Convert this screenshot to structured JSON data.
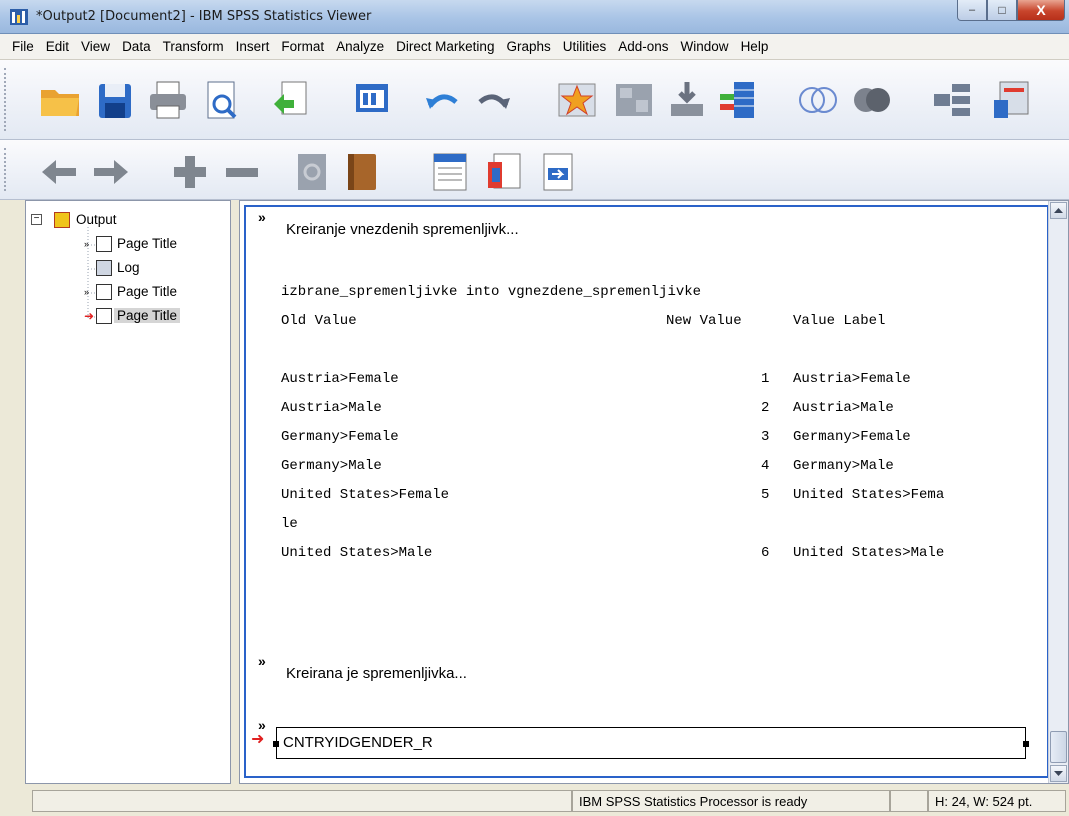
{
  "window": {
    "title": "*Output2 [Document2] - IBM SPSS Statistics Viewer",
    "minimize": "–",
    "maximize": "□",
    "close": "X"
  },
  "menu": [
    {
      "label": "File"
    },
    {
      "label": "Edit"
    },
    {
      "label": "View"
    },
    {
      "label": "Data"
    },
    {
      "label": "Transform"
    },
    {
      "label": "Insert"
    },
    {
      "label": "Format"
    },
    {
      "label": "Analyze"
    },
    {
      "label": "Direct Marketing"
    },
    {
      "label": "Graphs"
    },
    {
      "label": "Utilities"
    },
    {
      "label": "Add-ons"
    },
    {
      "label": "Window"
    },
    {
      "label": "Help"
    }
  ],
  "toolbar_icons": [
    "open-folder-icon",
    "save-icon",
    "print-icon",
    "print-preview-icon",
    "export-icon",
    "recall-dialog-icon",
    "undo-icon",
    "redo-icon",
    "goto-case-icon",
    "goto-variable-icon",
    "insert-data-icon",
    "variables-icon",
    "select-cases-icon",
    "weight-cases-icon",
    "split-file-icon",
    "value-labels-icon",
    "promote-icon",
    "demote-icon",
    "expand-icon",
    "collapse-icon",
    "show-icon",
    "hide-icon",
    "insert-heading-icon",
    "insert-title-icon",
    "insert-text-icon"
  ],
  "outline": {
    "root": "Output",
    "items": [
      {
        "label": "Page Title",
        "icon": "page-title-icon"
      },
      {
        "label": "Log",
        "icon": "log-icon"
      },
      {
        "label": "Page Title",
        "icon": "page-title-icon"
      },
      {
        "label": "Page Title",
        "icon": "page-title-icon",
        "selected": true
      }
    ]
  },
  "content": {
    "heading1": "Kreiranje vnezdenih spremenljivk...",
    "recode_title": "izbrane_spremenljivke into vgnezdene_spremenljivke",
    "col_old": "Old Value",
    "col_new": "New Value",
    "col_label": "Value Label",
    "rows": [
      {
        "old": "Austria>Female",
        "new": "1",
        "label": "Austria>Female"
      },
      {
        "old": "Austria>Male",
        "new": "2",
        "label": "Austria>Male"
      },
      {
        "old": "Germany>Female",
        "new": "3",
        "label": "Germany>Female"
      },
      {
        "old": "Germany>Male",
        "new": "4",
        "label": "Germany>Male"
      },
      {
        "old": "United States>Female",
        "new": "5",
        "label": "United States>Fema"
      },
      {
        "old": "le",
        "new": "",
        "label": ""
      },
      {
        "old": "United States>Male",
        "new": "6",
        "label": "United States>Male"
      }
    ],
    "heading2": "Kreirana je spremenljivka...",
    "edit_text": "CNTRYIDGENDER_R",
    "chevron": "»"
  },
  "status": {
    "processor": "IBM SPSS Statistics Processor is ready",
    "size": "H: 24, W: 524 pt."
  },
  "colors": {
    "selection": "#2a62c9",
    "title_gradient": "#a9c4e6"
  }
}
